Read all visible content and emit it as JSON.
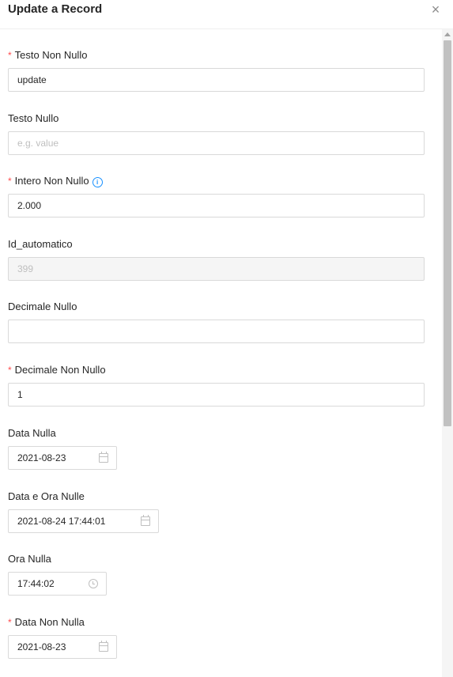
{
  "dialog": {
    "title": "Update a Record",
    "close_symbol": "×"
  },
  "fields": {
    "testo_non_nullo": {
      "required_mark": "*",
      "label": "Testo Non Nullo",
      "value": "update"
    },
    "testo_nullo": {
      "label": "Testo Nullo",
      "placeholder": "e.g. value"
    },
    "intero_non_nullo": {
      "required_mark": "*",
      "label": "Intero Non Nullo",
      "info_icon": "i",
      "value": "2.000"
    },
    "id_automatico": {
      "label": "Id_automatico",
      "value": "399"
    },
    "decimale_nullo": {
      "label": "Decimale Nullo",
      "value": ""
    },
    "decimale_non_nullo": {
      "required_mark": "*",
      "label": "Decimale Non Nullo",
      "value": "1"
    },
    "data_nulla": {
      "label": "Data Nulla",
      "value": "2021-08-23",
      "icon": "calendar-icon"
    },
    "data_e_ora_nulle": {
      "label": "Data e Ora Nulle",
      "value": "2021-08-24 17:44:01",
      "icon": "calendar-icon"
    },
    "ora_nulla": {
      "label": "Ora Nulla",
      "value": "17:44:02",
      "icon": "clock-icon"
    },
    "data_non_nulla": {
      "required_mark": "*",
      "label": "Data Non Nulla",
      "value": "2021-08-23",
      "icon": "calendar-icon"
    }
  },
  "colors": {
    "required": "#ff4d4f",
    "info": "#1890ff",
    "border": "#d9d9d9",
    "disabled_bg": "#f5f5f5",
    "placeholder": "#bfbfbf"
  }
}
